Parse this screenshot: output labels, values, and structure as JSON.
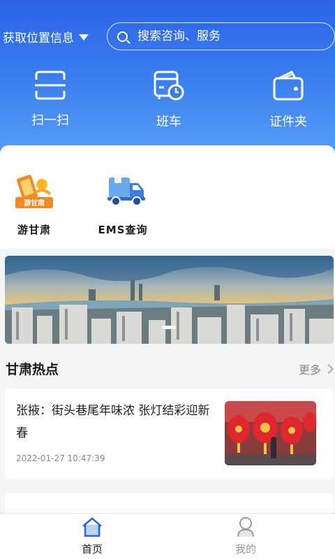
{
  "header": {
    "location_label": "获取位置信息",
    "search_placeholder": "搜索咨询、服务",
    "quick_actions": [
      {
        "label": "扫一扫",
        "icon": "scan-icon"
      },
      {
        "label": "班车",
        "icon": "bus-clock-icon"
      },
      {
        "label": "证件夹",
        "icon": "wallet-icon"
      }
    ]
  },
  "services": [
    {
      "label": "游甘肃",
      "icon": "you-gansu-app-icon",
      "icon_text": "游甘肃"
    },
    {
      "label": "EMS查询",
      "icon": "delivery-truck-icon"
    }
  ],
  "hot": {
    "title": "甘肃热点",
    "more_label": "更多",
    "items": [
      {
        "title": "张掖：街头巷尾年味浓 张灯结彩迎新春",
        "date": "2022-01-27 10:47:39"
      }
    ]
  },
  "tabbar": {
    "tabs": [
      {
        "label": "首页",
        "icon": "home-icon",
        "active": true
      },
      {
        "label": "我的",
        "icon": "profile-icon",
        "active": false
      }
    ]
  },
  "colors": {
    "brand_blue": "#2b63e6",
    "active_tab": "#1a1a1a",
    "inactive_tab": "#999999"
  }
}
